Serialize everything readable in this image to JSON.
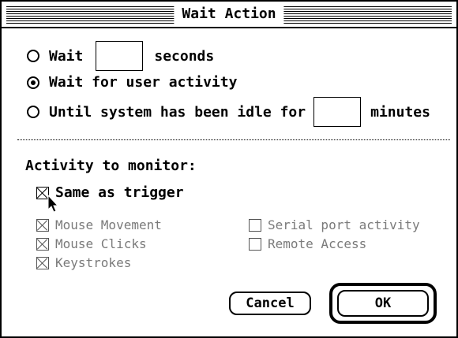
{
  "window": {
    "title": "Wait Action"
  },
  "wait_options": {
    "wait_prefix": "Wait",
    "wait_seconds_value": "",
    "wait_suffix": "seconds",
    "user_activity_label": "Wait for user activity",
    "idle_prefix": "Until system has been idle for",
    "idle_minutes_value": "",
    "idle_suffix": "minutes",
    "selected": "Wait for user activity"
  },
  "activity": {
    "heading": "Activity to monitor:",
    "same_as_trigger": {
      "label": "Same as trigger",
      "checked": true
    },
    "monitors": [
      {
        "label": "Mouse Movement",
        "checked": true,
        "enabled": false
      },
      {
        "label": "Mouse Clicks",
        "checked": true,
        "enabled": false
      },
      {
        "label": "Keystrokes",
        "checked": true,
        "enabled": false
      },
      {
        "label": "Serial port activity",
        "checked": false,
        "enabled": false
      },
      {
        "label": "Remote Access",
        "checked": false,
        "enabled": false
      }
    ]
  },
  "buttons": {
    "cancel_label": "Cancel",
    "ok_label": "OK"
  },
  "icons": {
    "cursor": "arrow-pointer-icon"
  }
}
